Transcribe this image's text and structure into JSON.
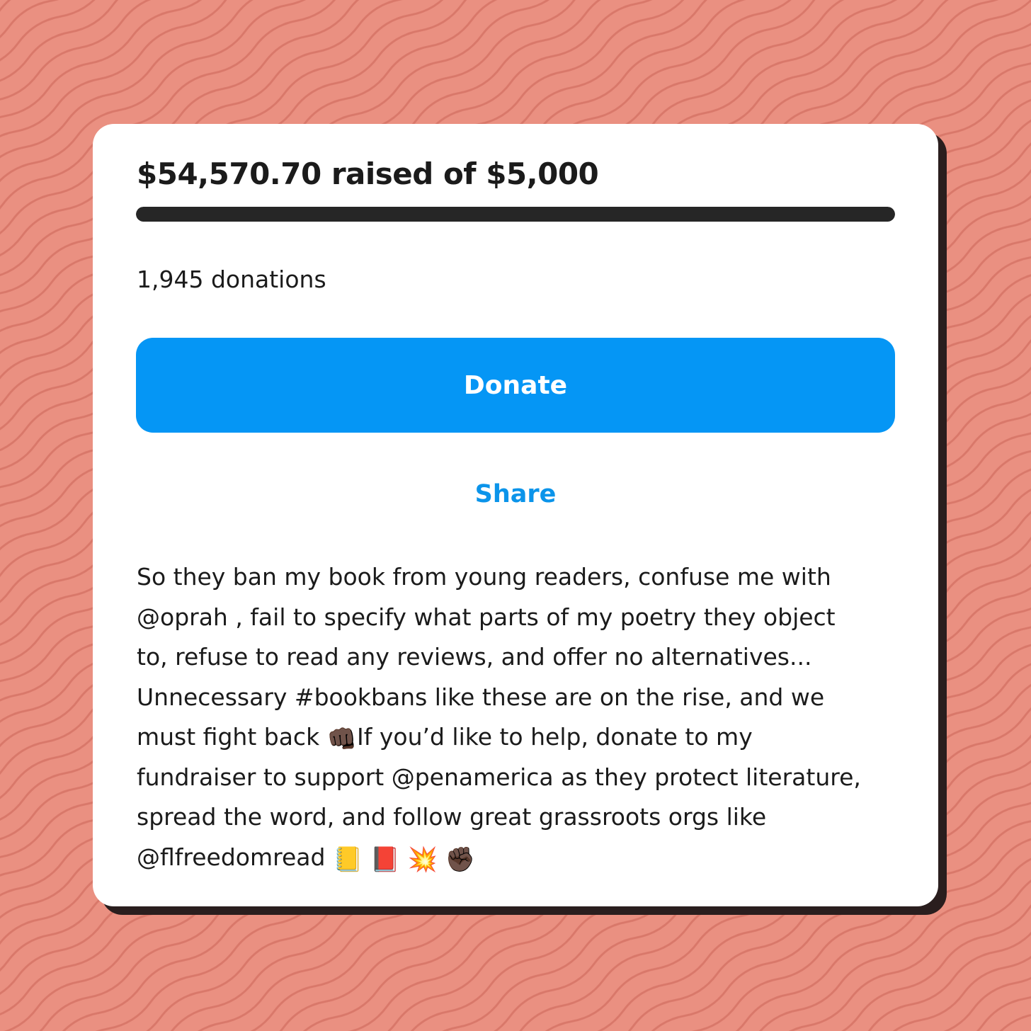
{
  "fundraiser": {
    "raised_title": "$54,570.70 raised of $5,000",
    "progress_fraction": 1.0,
    "donation_count": "1,945 donations",
    "donate_label": "Donate",
    "share_label": "Share"
  },
  "description": {
    "lines": [
      "So they ban my book from young readers, confuse me with",
      "@oprah , fail to specify what parts of my poetry they object",
      "to, refuse to read any reviews, and offer no alternatives...",
      "Unnecessary #bookbans like these are on the rise, and we",
      "must fight back ",
      "If you’d like to help, donate to my",
      "fundraiser to support @penamerica as they protect literature,",
      "spread the word, and follow great grassroots orgs like",
      "@flfreedomread "
    ],
    "emoji_fist_bump": "👊🏿",
    "emoji_notebook": "📒",
    "emoji_red_book": "📕",
    "emoji_collision": "💥",
    "emoji_raised_fist": "✊🏿"
  },
  "colors": {
    "background": "#ea9081",
    "wave_lines": "#d9786a",
    "card": "#ffffff",
    "card_shadow": "#2a1e1e",
    "progress_fill": "#262626",
    "donate_button": "#0596f5",
    "share_link": "#0b94ea",
    "text": "#1b1b1b"
  }
}
